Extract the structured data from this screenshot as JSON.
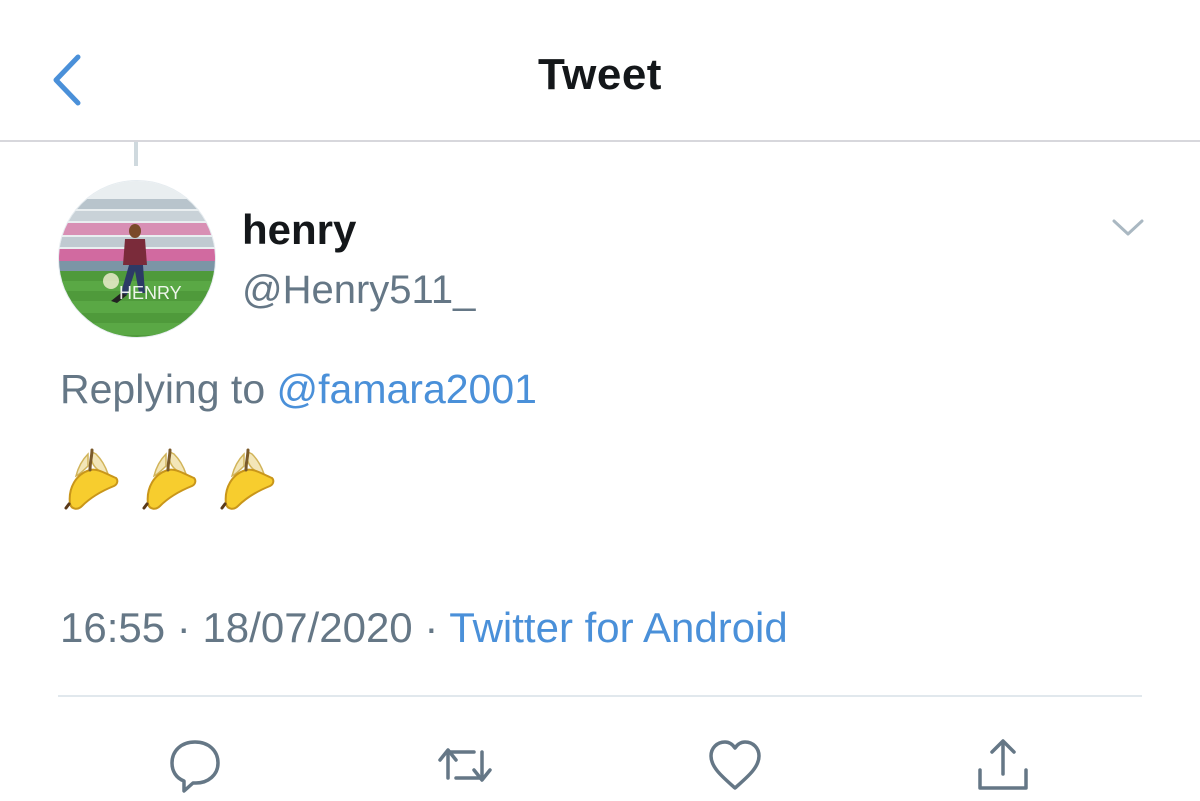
{
  "header": {
    "title": "Tweet",
    "back_icon": "chevron-left-icon"
  },
  "tweet": {
    "author": {
      "display_name": "henry",
      "handle": "@Henry511_",
      "avatar_text": "HENRY"
    },
    "reply": {
      "prefix": "Replying to",
      "mention": "@famara2001"
    },
    "body_emoji": [
      "banana-icon",
      "banana-icon",
      "banana-icon"
    ],
    "time": "16:55",
    "date": "18/07/2020",
    "separator": "·",
    "source": "Twitter for Android"
  },
  "actions": [
    "reply-icon",
    "retweet-icon",
    "like-icon",
    "share-icon"
  ],
  "colors": {
    "accent": "#4a90d9",
    "text_primary": "#14171a",
    "text_secondary": "#657786",
    "divider": "#e1e8ed"
  }
}
